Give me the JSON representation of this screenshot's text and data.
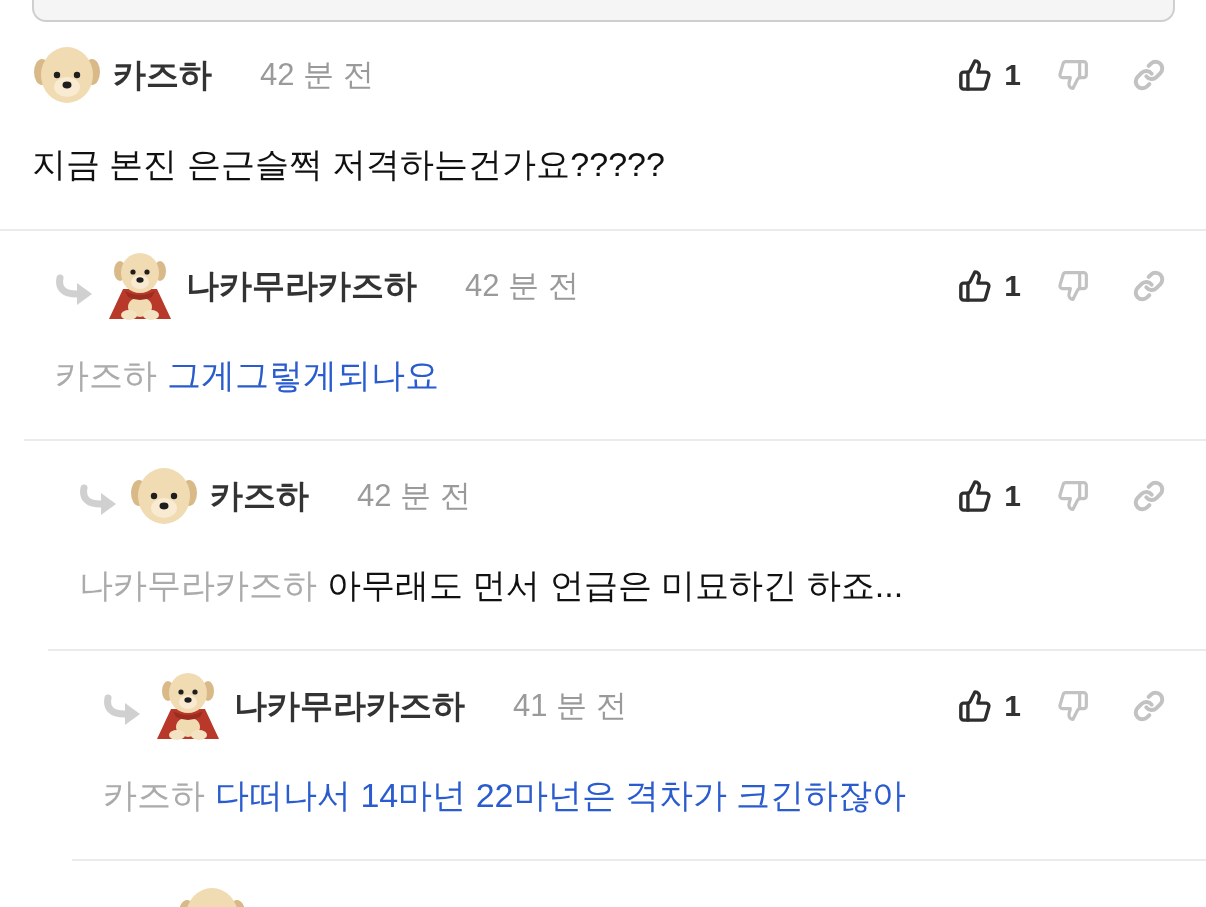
{
  "comments": [
    {
      "author": "카즈하",
      "avatar": {
        "kind": "puppy-head"
      },
      "time": "42 분 전",
      "likes": "1",
      "body": {
        "text": "지금 본진 은근슬쩍 저격하는건가요?????",
        "color": "#111111"
      },
      "children": [
        {
          "author": "나카무라카즈하",
          "avatar": {
            "kind": "puppy-cape"
          },
          "time": "42 분 전",
          "likes": "1",
          "body": {
            "mention": "카즈하",
            "text": "그게그렇게되나요",
            "color": "#2a5ccf"
          },
          "children": [
            {
              "author": "카즈하",
              "avatar": {
                "kind": "puppy-head"
              },
              "time": "42 분 전",
              "likes": "1",
              "body": {
                "mention": "나카무라카즈하",
                "text": "아무래도 먼서 언급은 미묘하긴 하죠...",
                "color": "#111111"
              },
              "children": [
                {
                  "author": "나카무라카즈하",
                  "avatar": {
                    "kind": "puppy-cape"
                  },
                  "time": "41 분 전",
                  "likes": "1",
                  "body": {
                    "mention": "카즈하",
                    "text": "다떠나서 14마넌 22마넌은 격차가 크긴하잖아",
                    "color": "#2a5ccf"
                  },
                  "children": [
                    {
                      "avatar": {
                        "kind": "puppy-head"
                      }
                    }
                  ]
                }
              ]
            }
          ]
        }
      ]
    }
  ]
}
